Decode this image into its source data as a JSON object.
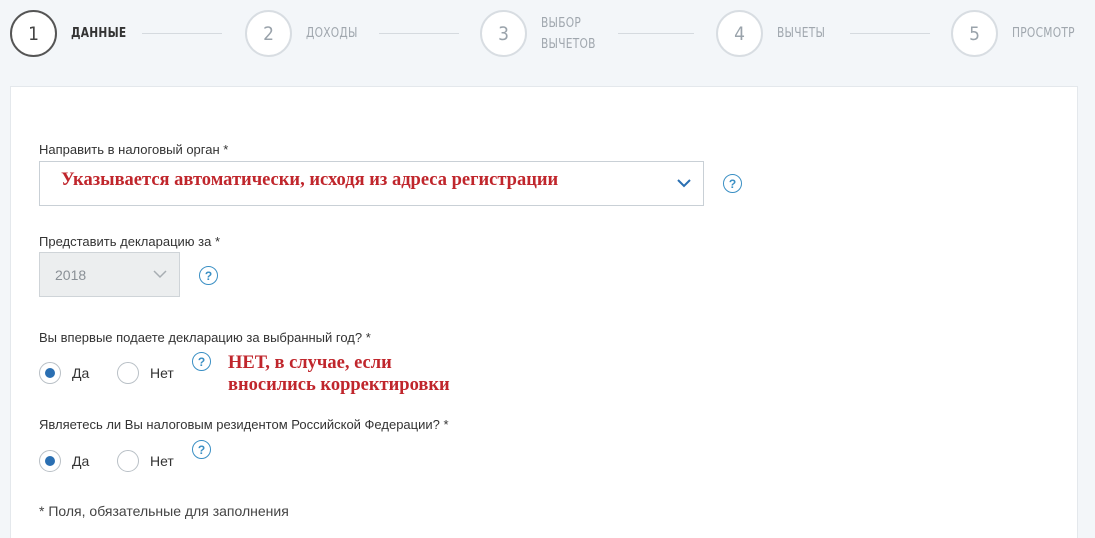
{
  "stepper": {
    "steps": [
      {
        "number": "1",
        "label": "ДАННЫЕ"
      },
      {
        "number": "2",
        "label": "ДОХОДЫ"
      },
      {
        "number": "3",
        "label_line1": "ВЫБОР",
        "label_line2": "ВЫЧЕТОВ"
      },
      {
        "number": "4",
        "label": "ВЫЧЕТЫ"
      },
      {
        "number": "5",
        "label": "ПРОСМОТР"
      }
    ],
    "active_step": 1
  },
  "form": {
    "tax_authority": {
      "label": "Направить в налоговый орган *",
      "annotation": "Указывается автоматически, исходя из адреса регистрации"
    },
    "year": {
      "label": "Представить декларацию за *",
      "value": "2018"
    },
    "first_time": {
      "label": "Вы впервые подаете декларацию за выбранный год? *",
      "option_yes": "Да",
      "option_no": "Нет",
      "selected": "Да",
      "annotation_line1": "НЕТ, в случае, если",
      "annotation_line2": "вносились корректировки"
    },
    "resident": {
      "label": "Являетесь ли Вы налоговым резидентом Российской Федерации? *",
      "option_yes": "Да",
      "option_no": "Нет",
      "selected": "Да"
    },
    "help_symbol": "?",
    "footnote": "* Поля, обязательные для заполнения"
  },
  "colors": {
    "accent": "#2a6fb2",
    "help": "#3a8fc4",
    "annotation": "#c0262c",
    "background": "#f3f6f9"
  },
  "icons": {
    "dropdown": "chevron-down-icon",
    "help": "question-circle-icon"
  }
}
